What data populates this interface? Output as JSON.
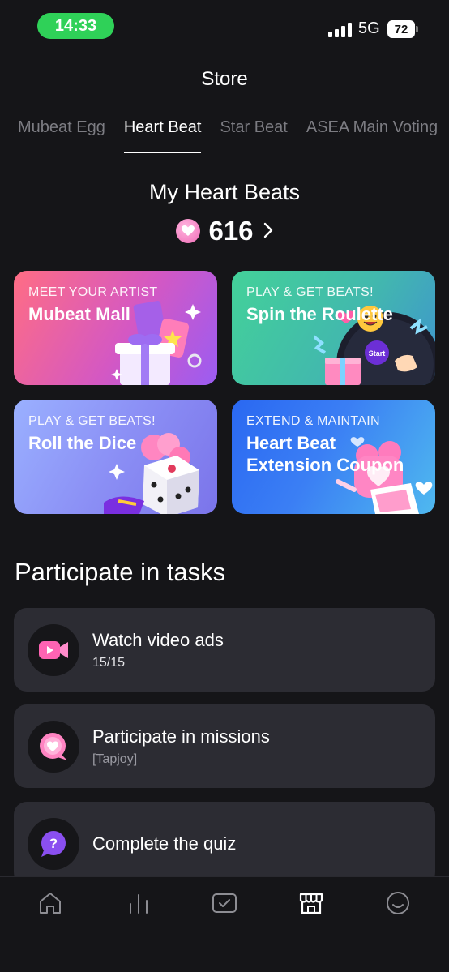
{
  "status_bar": {
    "time": "14:33",
    "network": "5G",
    "battery": "72"
  },
  "header": {
    "title": "Store"
  },
  "tabs": [
    {
      "label": "Mubeat Egg",
      "active": false
    },
    {
      "label": "Heart Beat",
      "active": true
    },
    {
      "label": "Star Beat",
      "active": false
    },
    {
      "label": "ASEA Main Voting",
      "active": false
    }
  ],
  "balance": {
    "heading": "My Heart Beats",
    "amount": "616",
    "icon": "heart-coin-icon",
    "more_icon": "chevron-right-icon"
  },
  "cards": [
    {
      "kicker": "MEET YOUR ARTIST",
      "title": "Mubeat Mall",
      "art": "gift-box-art"
    },
    {
      "kicker": "PLAY & GET BEATS!",
      "title": "Spin the Roulette",
      "art": "roulette-art",
      "badge": "Start"
    },
    {
      "kicker": "PLAY & GET BEATS!",
      "title": "Roll the Dice",
      "art": "dice-art"
    },
    {
      "kicker": "EXTEND & MAINTAIN",
      "title_line1": "Heart Beat",
      "title_line2": "Extension Coupon",
      "art": "coupon-art"
    }
  ],
  "tasks_section": {
    "title": "Participate in tasks",
    "items": [
      {
        "title": "Watch video ads",
        "subtitle": "15/15",
        "icon": "video-camera-icon"
      },
      {
        "title": "Participate in missions",
        "subtitle": "[Tapjoy]",
        "icon": "heart-chat-icon"
      },
      {
        "title": "Complete the quiz",
        "subtitle": "",
        "icon": "question-bubble-icon"
      }
    ]
  },
  "bottom_nav": [
    {
      "name": "home",
      "icon": "home-icon",
      "active": false
    },
    {
      "name": "chart",
      "icon": "chart-icon",
      "active": false
    },
    {
      "name": "check",
      "icon": "check-box-icon",
      "active": false
    },
    {
      "name": "store",
      "icon": "store-icon",
      "active": true
    },
    {
      "name": "profile",
      "icon": "smiley-icon",
      "active": false
    }
  ],
  "colors": {
    "background": "#151518",
    "card_surface": "#2c2c33",
    "time_pill": "#2fd158",
    "inactive_tab": "#7c7c82"
  }
}
